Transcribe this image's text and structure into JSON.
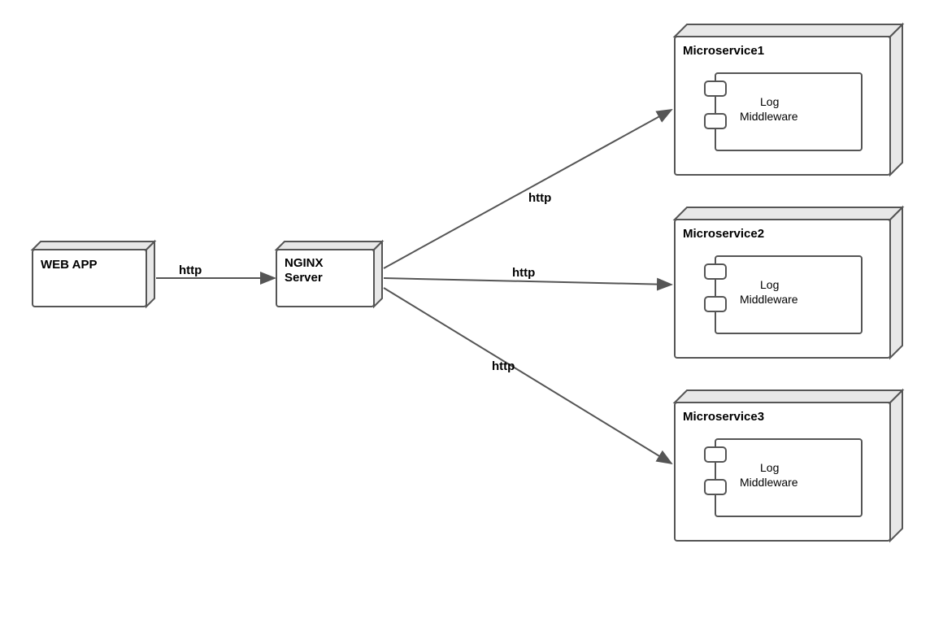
{
  "diagram": {
    "nodes": {
      "webapp": {
        "label": "WEB APP"
      },
      "nginx": {
        "label1": "NGINX",
        "label2": "Server"
      },
      "ms1": {
        "label": "Microservice1",
        "component1": "Log",
        "component2": "Middleware"
      },
      "ms2": {
        "label": "Microservice2",
        "component1": "Log",
        "component2": "Middleware"
      },
      "ms3": {
        "label": "Microservice3",
        "component1": "Log",
        "component2": "Middleware"
      }
    },
    "edges": {
      "webapp_nginx": {
        "label": "http"
      },
      "nginx_ms1": {
        "label": "http"
      },
      "nginx_ms2": {
        "label": "http"
      },
      "nginx_ms3": {
        "label": "http"
      }
    }
  },
  "chart_data": {
    "type": "architecture-diagram",
    "nodes": [
      {
        "id": "webapp",
        "label": "WEB APP",
        "type": "node"
      },
      {
        "id": "nginx",
        "label": "NGINX Server",
        "type": "node"
      },
      {
        "id": "ms1",
        "label": "Microservice1",
        "type": "container",
        "components": [
          "Log Middleware"
        ]
      },
      {
        "id": "ms2",
        "label": "Microservice2",
        "type": "container",
        "components": [
          "Log Middleware"
        ]
      },
      {
        "id": "ms3",
        "label": "Microservice3",
        "type": "container",
        "components": [
          "Log Middleware"
        ]
      }
    ],
    "edges": [
      {
        "from": "webapp",
        "to": "nginx",
        "label": "http"
      },
      {
        "from": "nginx",
        "to": "ms1",
        "label": "http"
      },
      {
        "from": "nginx",
        "to": "ms2",
        "label": "http"
      },
      {
        "from": "nginx",
        "to": "ms3",
        "label": "http"
      }
    ]
  }
}
